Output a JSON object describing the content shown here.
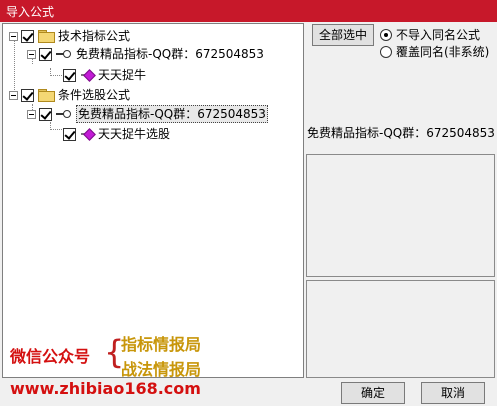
{
  "window": {
    "title": "导入公式"
  },
  "tree": {
    "group1": {
      "label": "技术指标公式"
    },
    "group1_item": {
      "label": "免费精品指标-QQ群：672504853"
    },
    "group1_sub": {
      "label": "天天捉牛"
    },
    "group2": {
      "label": "条件选股公式"
    },
    "group2_item": {
      "label": "免费精品指标-QQ群：672504853"
    },
    "group2_sub": {
      "label": "天天捉牛选股"
    }
  },
  "right": {
    "select_all_label": "全部选中",
    "radio_no_import": "不导入同名公式",
    "radio_overwrite": "覆盖同名(非系统)",
    "selected_name": "免费精品指标-QQ群：672504853"
  },
  "buttons": {
    "ok": "确定",
    "cancel": "取消"
  },
  "overlay": {
    "wechat": "微信公众号",
    "line1": "指标情报局",
    "line2": "战法情报局",
    "url": "www.zhibiao168.com"
  }
}
